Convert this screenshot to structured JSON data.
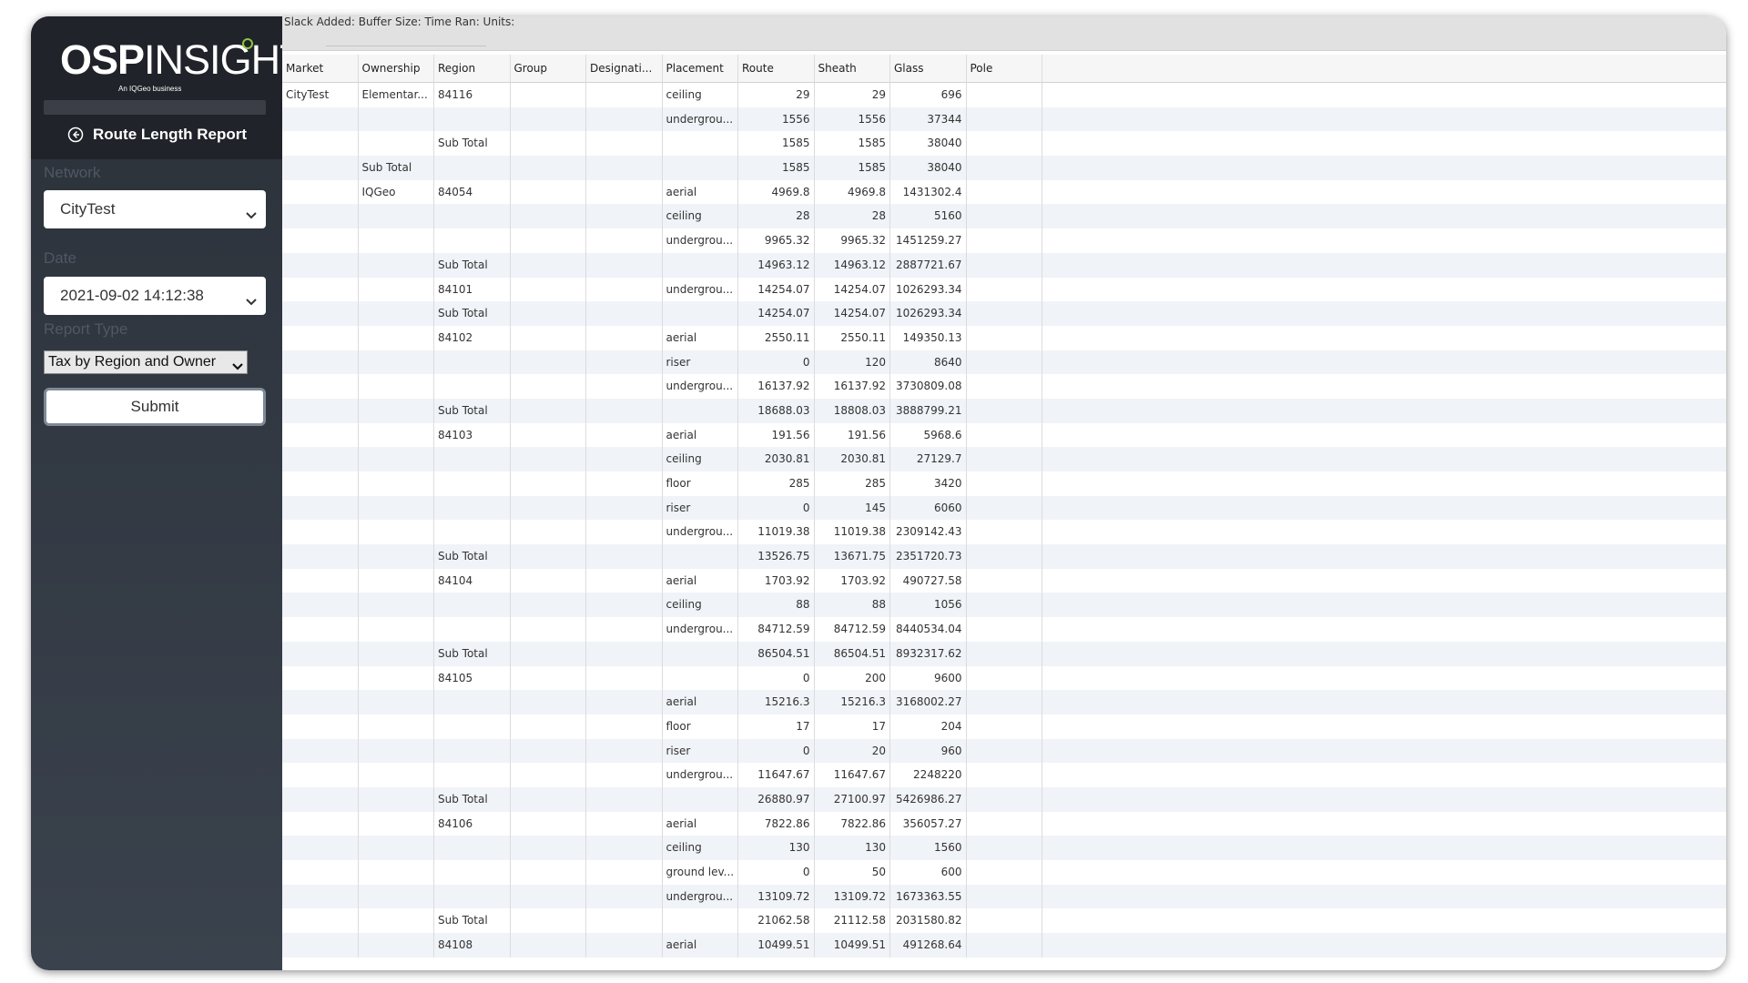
{
  "app": {
    "logo_bold": "OSP",
    "logo_light": "INSIGHT",
    "logo_tagline": "An IQGeo business",
    "report_title": "Route Length Report"
  },
  "form": {
    "network_label": "Network",
    "network_value": "CityTest",
    "date_label": "Date",
    "date_value": "2021-09-02 14:12:38",
    "report_type_label": "Report Type",
    "report_type_value": "Tax by Region and Owner",
    "submit_label": "Submit"
  },
  "info_bar": {
    "text": "Slack Added: Buffer Size: Time Ran: Units:"
  },
  "table": {
    "columns": [
      "Market",
      "Ownership",
      "Region",
      "Group",
      "Designati...",
      "Placement",
      "Route",
      "Sheath",
      "Glass",
      "Pole"
    ],
    "rows": [
      [
        "CityTest",
        "Elementar...",
        "84116",
        "",
        "",
        "ceiling",
        "29",
        "29",
        "696",
        ""
      ],
      [
        "",
        "",
        "",
        "",
        "",
        "undergrou...",
        "1556",
        "1556",
        "37344",
        ""
      ],
      [
        "",
        "",
        "Sub Total",
        "",
        "",
        "",
        "1585",
        "1585",
        "38040",
        ""
      ],
      [
        "",
        "Sub Total",
        "",
        "",
        "",
        "",
        "1585",
        "1585",
        "38040",
        ""
      ],
      [
        "",
        "IQGeo",
        "84054",
        "",
        "",
        "aerial",
        "4969.8",
        "4969.8",
        "1431302.4",
        ""
      ],
      [
        "",
        "",
        "",
        "",
        "",
        "ceiling",
        "28",
        "28",
        "5160",
        ""
      ],
      [
        "",
        "",
        "",
        "",
        "",
        "undergrou...",
        "9965.32",
        "9965.32",
        "1451259.27",
        ""
      ],
      [
        "",
        "",
        "Sub Total",
        "",
        "",
        "",
        "14963.12",
        "14963.12",
        "2887721.67",
        ""
      ],
      [
        "",
        "",
        "84101",
        "",
        "",
        "undergrou...",
        "14254.07",
        "14254.07",
        "1026293.34",
        ""
      ],
      [
        "",
        "",
        "Sub Total",
        "",
        "",
        "",
        "14254.07",
        "14254.07",
        "1026293.34",
        ""
      ],
      [
        "",
        "",
        "84102",
        "",
        "",
        "aerial",
        "2550.11",
        "2550.11",
        "149350.13",
        ""
      ],
      [
        "",
        "",
        "",
        "",
        "",
        "riser",
        "0",
        "120",
        "8640",
        ""
      ],
      [
        "",
        "",
        "",
        "",
        "",
        "undergrou...",
        "16137.92",
        "16137.92",
        "3730809.08",
        ""
      ],
      [
        "",
        "",
        "Sub Total",
        "",
        "",
        "",
        "18688.03",
        "18808.03",
        "3888799.21",
        ""
      ],
      [
        "",
        "",
        "84103",
        "",
        "",
        "aerial",
        "191.56",
        "191.56",
        "5968.6",
        ""
      ],
      [
        "",
        "",
        "",
        "",
        "",
        "ceiling",
        "2030.81",
        "2030.81",
        "27129.7",
        ""
      ],
      [
        "",
        "",
        "",
        "",
        "",
        "floor",
        "285",
        "285",
        "3420",
        ""
      ],
      [
        "",
        "",
        "",
        "",
        "",
        "riser",
        "0",
        "145",
        "6060",
        ""
      ],
      [
        "",
        "",
        "",
        "",
        "",
        "undergrou...",
        "11019.38",
        "11019.38",
        "2309142.43",
        ""
      ],
      [
        "",
        "",
        "Sub Total",
        "",
        "",
        "",
        "13526.75",
        "13671.75",
        "2351720.73",
        ""
      ],
      [
        "",
        "",
        "84104",
        "",
        "",
        "aerial",
        "1703.92",
        "1703.92",
        "490727.58",
        ""
      ],
      [
        "",
        "",
        "",
        "",
        "",
        "ceiling",
        "88",
        "88",
        "1056",
        ""
      ],
      [
        "",
        "",
        "",
        "",
        "",
        "undergrou...",
        "84712.59",
        "84712.59",
        "8440534.04",
        ""
      ],
      [
        "",
        "",
        "Sub Total",
        "",
        "",
        "",
        "86504.51",
        "86504.51",
        "8932317.62",
        ""
      ],
      [
        "",
        "",
        "84105",
        "",
        "",
        "",
        "0",
        "200",
        "9600",
        ""
      ],
      [
        "",
        "",
        "",
        "",
        "",
        "aerial",
        "15216.3",
        "15216.3",
        "3168002.27",
        ""
      ],
      [
        "",
        "",
        "",
        "",
        "",
        "floor",
        "17",
        "17",
        "204",
        ""
      ],
      [
        "",
        "",
        "",
        "",
        "",
        "riser",
        "0",
        "20",
        "960",
        ""
      ],
      [
        "",
        "",
        "",
        "",
        "",
        "undergrou...",
        "11647.67",
        "11647.67",
        "2248220",
        ""
      ],
      [
        "",
        "",
        "Sub Total",
        "",
        "",
        "",
        "26880.97",
        "27100.97",
        "5426986.27",
        ""
      ],
      [
        "",
        "",
        "84106",
        "",
        "",
        "aerial",
        "7822.86",
        "7822.86",
        "356057.27",
        ""
      ],
      [
        "",
        "",
        "",
        "",
        "",
        "ceiling",
        "130",
        "130",
        "1560",
        ""
      ],
      [
        "",
        "",
        "",
        "",
        "",
        "ground lev...",
        "0",
        "50",
        "600",
        ""
      ],
      [
        "",
        "",
        "",
        "",
        "",
        "undergrou...",
        "13109.72",
        "13109.72",
        "1673363.55",
        ""
      ],
      [
        "",
        "",
        "Sub Total",
        "",
        "",
        "",
        "21062.58",
        "21112.58",
        "2031580.82",
        ""
      ],
      [
        "",
        "",
        "84108",
        "",
        "",
        "aerial",
        "10499.51",
        "10499.51",
        "491268.64",
        ""
      ]
    ],
    "numeric_columns": [
      6,
      7,
      8
    ]
  },
  "colors": {
    "sidebar_bg": "#323943",
    "sidebar_head_bg": "#202329",
    "logo_accent": "#8cc63f",
    "row_alt": "#f0f3f7"
  },
  "icons": {
    "back": "circle-arrow-left-icon",
    "dropdown": "chevron-down-icon"
  }
}
